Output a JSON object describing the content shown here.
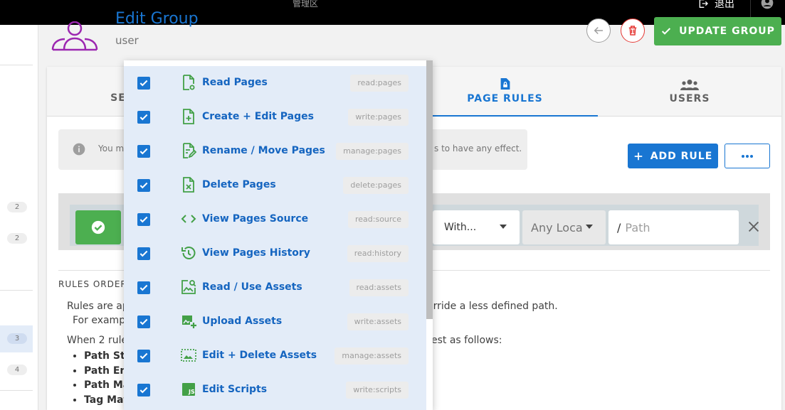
{
  "topbar": {
    "center_text": "管理区",
    "logout_label": "退出"
  },
  "sidebar": {
    "counts": [
      "2",
      "2",
      "3",
      "4"
    ]
  },
  "header": {
    "title": "Edit Group",
    "subtitle": "user",
    "update_label": "UPDATE GROUP"
  },
  "tabs": {
    "settings": "SE",
    "page_rules": "PAGE RULES",
    "users": "USERS"
  },
  "info": {
    "left": "You m",
    "right": "s to have any effect."
  },
  "actions": {
    "add_rule": "ADD RULE"
  },
  "rule": {
    "match": "With...",
    "locale": "Any Loca",
    "path_prefix": "/",
    "path_placeholder": "Path"
  },
  "order": {
    "title": "RULES ORDER",
    "line1": "Rules are ap",
    "line1_right": "erride a less defined path.",
    "line2": "For exampl",
    "line3": "When 2 rules",
    "line3_right": "est as follows:",
    "items": [
      "Path Sta",
      "Path End",
      "Path Mat",
      "Tag Matc"
    ]
  },
  "menu": {
    "items": [
      {
        "label": "Read Pages",
        "code": "read:pages",
        "icon": "page-view-icon"
      },
      {
        "label": "Create + Edit Pages",
        "code": "write:pages",
        "icon": "page-add-icon"
      },
      {
        "label": "Rename / Move Pages",
        "code": "manage:pages",
        "icon": "page-edit-icon"
      },
      {
        "label": "Delete Pages",
        "code": "delete:pages",
        "icon": "page-delete-icon"
      },
      {
        "label": "View Pages Source",
        "code": "read:source",
        "icon": "code-icon"
      },
      {
        "label": "View Pages History",
        "code": "read:history",
        "icon": "history-icon"
      },
      {
        "label": "Read / Use Assets",
        "code": "read:assets",
        "icon": "image-search-icon"
      },
      {
        "label": "Upload Assets",
        "code": "write:assets",
        "icon": "image-plus-icon"
      },
      {
        "label": "Edit + Delete Assets",
        "code": "manage:assets",
        "icon": "image-edit-icon"
      },
      {
        "label": "Edit Scripts",
        "code": "write:scripts",
        "icon": "script-icon"
      }
    ]
  },
  "colors": {
    "primary": "#1976d2",
    "success": "#4caf50",
    "danger": "#e53935",
    "menu_bg": "#e3ecf8"
  }
}
